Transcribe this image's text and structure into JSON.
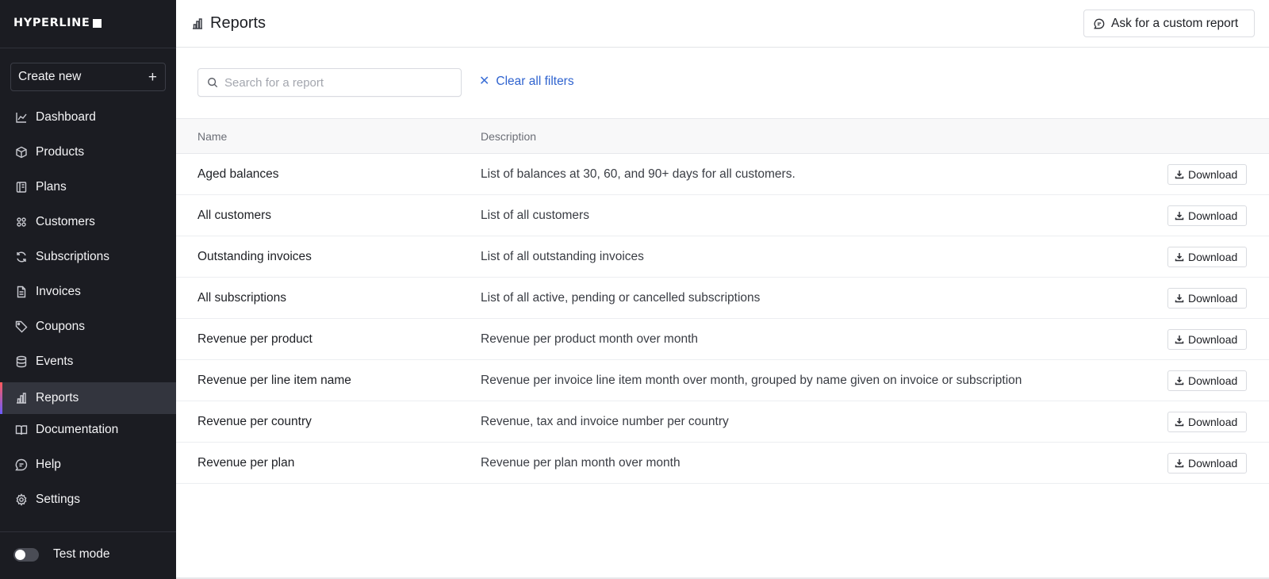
{
  "app": {
    "logo": "HYPERLINE"
  },
  "sidebar": {
    "create_new": "Create new",
    "items": [
      {
        "label": "Dashboard",
        "icon": "chart-line-icon"
      },
      {
        "label": "Products",
        "icon": "box-icon"
      },
      {
        "label": "Plans",
        "icon": "book-icon"
      },
      {
        "label": "Customers",
        "icon": "users-icon"
      },
      {
        "label": "Subscriptions",
        "icon": "refresh-icon"
      },
      {
        "label": "Invoices",
        "icon": "file-icon"
      },
      {
        "label": "Coupons",
        "icon": "tag-icon"
      },
      {
        "label": "Events",
        "icon": "database-icon"
      },
      {
        "label": "Reports",
        "icon": "bar-chart-icon",
        "active": true
      },
      {
        "label": "Documentation",
        "icon": "open-book-icon"
      },
      {
        "label": "Help",
        "icon": "chat-icon"
      },
      {
        "label": "Settings",
        "icon": "gear-icon"
      }
    ],
    "test_mode": "Test mode"
  },
  "header": {
    "title": "Reports",
    "ask_button": "Ask for a custom report"
  },
  "filters": {
    "search_placeholder": "Search for a report",
    "search_value": "",
    "clear_label": "Clear all filters"
  },
  "table": {
    "columns": [
      "Name",
      "Description"
    ],
    "download_label": "Download",
    "rows": [
      {
        "name": "Aged balances",
        "description": "List of balances at 30, 60, and 90+ days for all customers."
      },
      {
        "name": "All customers",
        "description": "List of all customers"
      },
      {
        "name": "Outstanding invoices",
        "description": "List of all outstanding invoices"
      },
      {
        "name": "All subscriptions",
        "description": "List of all active, pending or cancelled subscriptions"
      },
      {
        "name": "Revenue per product",
        "description": "Revenue per product month over month"
      },
      {
        "name": "Revenue per line item name",
        "description": "Revenue per invoice line item month over month, grouped by name given on invoice or subscription"
      },
      {
        "name": "Revenue per country",
        "description": "Revenue, tax and invoice number per country"
      },
      {
        "name": "Revenue per plan",
        "description": "Revenue per plan month over month"
      }
    ]
  },
  "colors": {
    "sidebar_bg": "#1b1c22",
    "sidebar_active": "#33353e",
    "link_blue": "#2f63cf"
  }
}
